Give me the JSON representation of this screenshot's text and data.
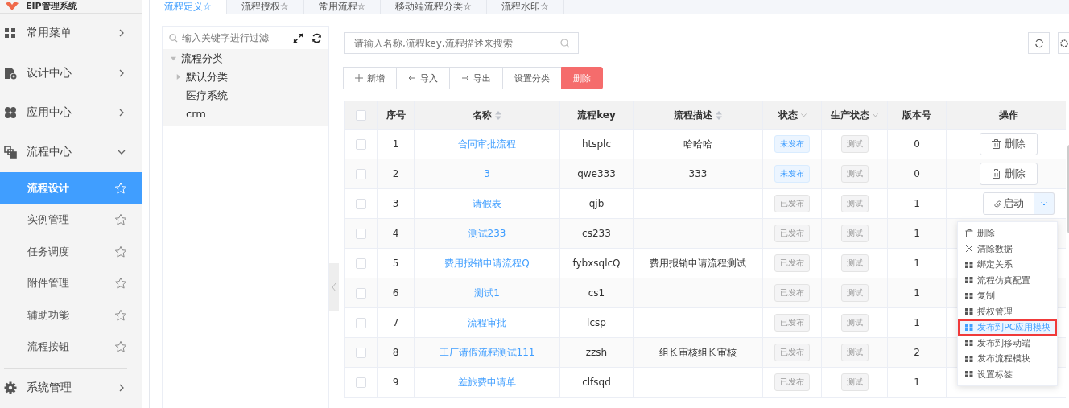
{
  "app": {
    "title": "EIP管理系统"
  },
  "sidebar": {
    "items": [
      {
        "label": "常用菜单",
        "expanded": false
      },
      {
        "label": "设计中心",
        "expanded": false
      },
      {
        "label": "应用中心",
        "expanded": false
      },
      {
        "label": "流程中心",
        "expanded": true,
        "children": [
          {
            "label": "流程设计",
            "selected": true
          },
          {
            "label": "实例管理",
            "selected": false
          },
          {
            "label": "任务调度",
            "selected": false
          },
          {
            "label": "附件管理",
            "selected": false
          },
          {
            "label": "辅助功能",
            "selected": false
          },
          {
            "label": "流程按钮",
            "selected": false
          }
        ]
      },
      {
        "label": "系统管理",
        "expanded": false
      }
    ]
  },
  "tabs": [
    {
      "label": "流程定义☆",
      "selected": true
    },
    {
      "label": "流程授权☆",
      "selected": false
    },
    {
      "label": "常用流程☆",
      "selected": false
    },
    {
      "label": "移动端流程分类☆",
      "selected": false
    },
    {
      "label": "流程水印☆",
      "selected": false
    }
  ],
  "tree": {
    "placeholder": "输入关键字进行过滤",
    "nodes": [
      {
        "label": "流程分类",
        "expanded": true,
        "children": [
          {
            "label": "默认分类",
            "expanded": false
          },
          {
            "label": "医疗系统"
          },
          {
            "label": "crm"
          }
        ]
      }
    ]
  },
  "search": {
    "placeholder": "请输入名称,流程key,流程描述来搜索"
  },
  "toolbar": [
    {
      "label": "新增",
      "kind": "add"
    },
    {
      "label": "导入",
      "kind": "import"
    },
    {
      "label": "导出",
      "kind": "export"
    },
    {
      "label": "设置分类",
      "kind": "plain"
    },
    {
      "label": "删除",
      "kind": "danger"
    }
  ],
  "table": {
    "all_checked": false,
    "columns": [
      {
        "label": "序号"
      },
      {
        "label": "名称",
        "sortable": true
      },
      {
        "label": "流程key"
      },
      {
        "label": "流程描述",
        "sortable": true
      },
      {
        "label": "状态",
        "filter": true
      },
      {
        "label": "生产状态",
        "filter": true
      },
      {
        "label": "版本号"
      },
      {
        "label": "操作"
      }
    ],
    "rows": [
      {
        "index": "1",
        "name": "合同审批流程",
        "key": "htsplc",
        "desc": "哈哈哈",
        "status": "未发布",
        "published": false,
        "prod": "测试",
        "version": "0",
        "action": {
          "kind": "delete",
          "label": "删除"
        },
        "checked": false
      },
      {
        "index": "2",
        "name": "3",
        "key": "qwe333",
        "desc": "333",
        "status": "未发布",
        "published": false,
        "prod": "测试",
        "version": "0",
        "action": {
          "kind": "delete",
          "label": "删除"
        },
        "checked": false
      },
      {
        "index": "3",
        "name": "请假表",
        "key": "qjb",
        "status": "已发布",
        "published": true,
        "prod": "测试",
        "version": "1",
        "action": {
          "kind": "start",
          "label": "启动",
          "expanded": true
        },
        "checked": false
      },
      {
        "index": "4",
        "name": "测试233",
        "key": "cs233",
        "status": "已发布",
        "published": true,
        "prod": "测试",
        "version": "1",
        "checked": false
      },
      {
        "index": "5",
        "name": "费用报销申请流程Q",
        "key": "fybxsqlcQ",
        "desc": "费用报销申请流程测试",
        "status": "已发布",
        "published": true,
        "prod": "测试",
        "version": "1",
        "checked": false
      },
      {
        "index": "6",
        "name": "测试1",
        "key": "cs1",
        "status": "已发布",
        "published": true,
        "prod": "测试",
        "version": "1",
        "checked": false
      },
      {
        "index": "7",
        "name": "流程审批",
        "key": "lcsp",
        "status": "已发布",
        "published": true,
        "prod": "测试",
        "version": "1",
        "checked": false
      },
      {
        "index": "8",
        "name": "工厂请假流程测试111",
        "key": "zzsh",
        "desc": "组长审核组长审核",
        "status": "已发布",
        "published": true,
        "prod": "测试",
        "version": "2",
        "checked": false
      },
      {
        "index": "9",
        "name": "差旅费申请单",
        "key": "clfsqd",
        "status": "已发布",
        "published": true,
        "prod": "测试",
        "version": "1",
        "checked": false
      }
    ]
  },
  "dropdown": {
    "items": [
      {
        "label": "删除",
        "selected": false,
        "highlighted": false
      },
      {
        "label": "清除数据",
        "selected": false,
        "highlighted": false
      },
      {
        "label": "绑定关系",
        "selected": false,
        "highlighted": false
      },
      {
        "label": "流程仿真配置",
        "selected": false,
        "highlighted": false
      },
      {
        "label": "复制",
        "selected": false,
        "highlighted": false
      },
      {
        "label": "授权管理",
        "selected": false,
        "highlighted": false
      },
      {
        "label": "发布到PC应用模块",
        "selected": true,
        "highlighted": true
      },
      {
        "label": "发布到移动端",
        "selected": false,
        "highlighted": false
      },
      {
        "label": "发布流程模块",
        "selected": false,
        "highlighted": false
      },
      {
        "label": "设置标签",
        "selected": false,
        "highlighted": false
      }
    ]
  }
}
